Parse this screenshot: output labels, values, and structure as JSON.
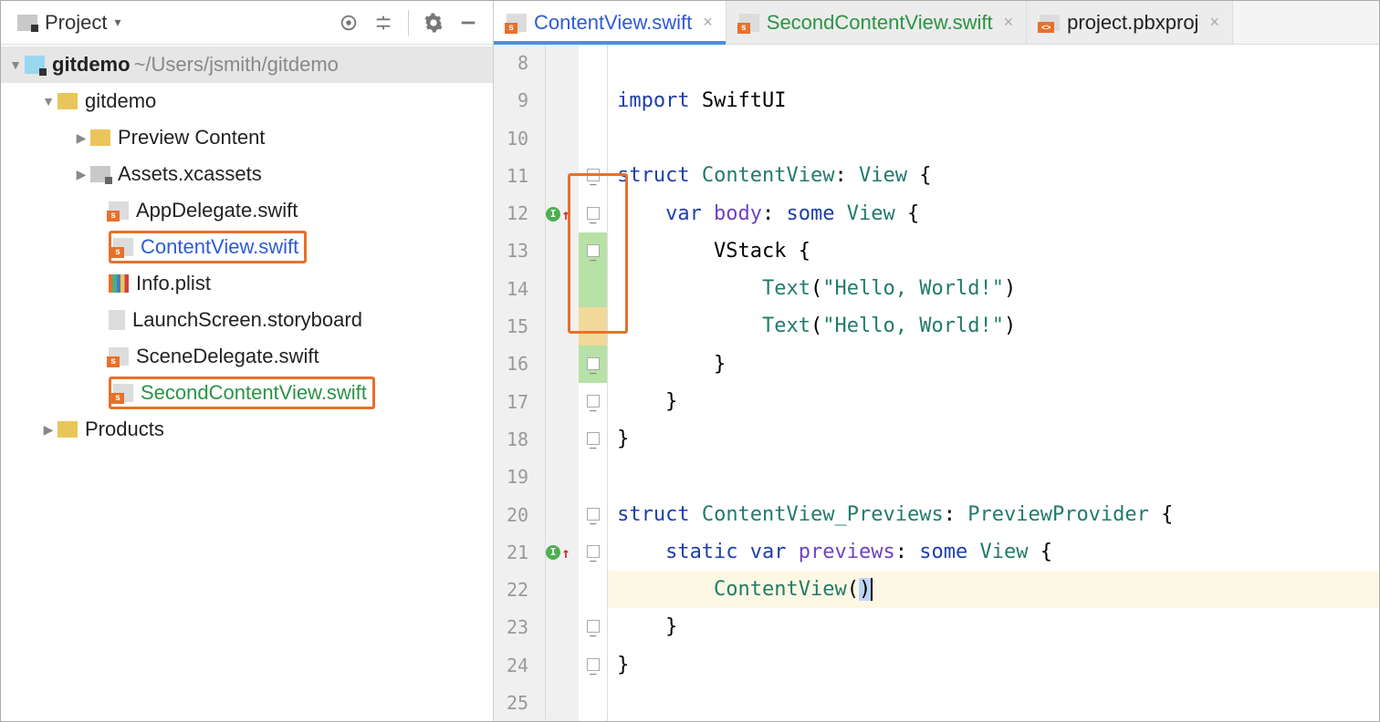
{
  "toolbar": {
    "projectLabel": "Project"
  },
  "tree": {
    "root": {
      "name": "gitdemo",
      "path": "~/Users/jsmith/gitdemo"
    },
    "folder1": "gitdemo",
    "preview": "Preview Content",
    "assets": "Assets.xcassets",
    "appDelegate": "AppDelegate.swift",
    "contentView": "ContentView.swift",
    "infoPlist": "Info.plist",
    "launchScreen": "LaunchScreen.storyboard",
    "sceneDelegate": "SceneDelegate.swift",
    "secondContentView": "SecondContentView.swift",
    "products": "Products"
  },
  "tabs": {
    "t1": "ContentView.swift",
    "t2": "SecondContentView.swift",
    "t3": "project.pbxproj"
  },
  "code": {
    "lineStart": 8,
    "l9a": "import",
    "l9b": " SwiftUI",
    "l11a": "struct",
    "l11b": " ContentView",
    "l11c": ": ",
    "l11d": "View",
    "l11e": " {",
    "l12a": "    var",
    "l12b": " body",
    "l12c": ": ",
    "l12d": "some",
    "l12e": " View",
    "l12f": " {",
    "l13a": "        VStack {",
    "l14a": "            Text",
    "l14b": "(",
    "l14c": "\"Hello, World!\"",
    "l14d": ")",
    "l15a": "            Text",
    "l15b": "(",
    "l15c": "\"Hello, World!\"",
    "l15d": ")",
    "l16a": "        }",
    "l17a": "    }",
    "l18a": "}",
    "l20a": "struct",
    "l20b": " ContentView_Previews",
    "l20c": ": ",
    "l20d": "PreviewProvider",
    "l20e": " {",
    "l21a": "    static",
    "l21b": " var",
    "l21c": " previews",
    "l21d": ": ",
    "l21e": "some",
    "l21f": " View",
    "l21g": " {",
    "l22a": "        ContentView",
    "l22b": "(",
    "l22c": ")",
    "l23a": "    }",
    "l24a": "}",
    "numbers": [
      "8",
      "9",
      "10",
      "11",
      "12",
      "13",
      "14",
      "15",
      "16",
      "17",
      "18",
      "19",
      "20",
      "21",
      "22",
      "23",
      "24",
      "25"
    ]
  }
}
